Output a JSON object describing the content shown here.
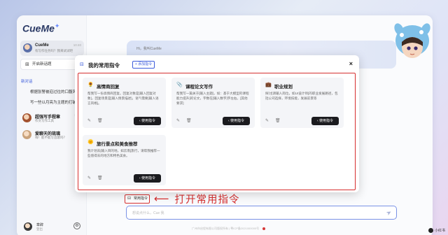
{
  "app": {
    "logo": "CueMe"
  },
  "sidebar": {
    "active_conversation": {
      "name": "CueMe",
      "subtitle": "有写作任务吗？我来试试吧",
      "time": "10:40"
    },
    "new_chat_label": "开启新话题",
    "section_label": "新对话",
    "history": [
      "根据张警被迫过往的口腹风格，",
      "写一些以月亮为主题的打破"
    ],
    "conversations": [
      {
        "name": "超强写手程章",
        "subtitle": "作文写作工具",
        "time": "10:37"
      },
      {
        "name": "爱聊天的琉璃",
        "subtitle": "嗨！能不能写首歌吗？",
        "time": ""
      }
    ],
    "user": {
      "name": "章辞",
      "sub": "登出"
    }
  },
  "main": {
    "banner_text": "Hi，我叫CueMe",
    "input_placeholder": "想说点什么，Cue 我",
    "command_button": "常用指令",
    "annotation": "打开常用指令",
    "footer": "广州市启程有限公司版权所有 | 粤ICP备2021000000号"
  },
  "modal": {
    "title": "我的常用指令",
    "add_button": "+ 添加指令",
    "close": "×",
    "cards": [
      {
        "emoji": "🌻",
        "title": "高情商回复",
        "desc": "帮我写一份高情商回复。回复对象是[输入回复对象]，回复场景是[输入情景描述]，语气需要[输入语言风格]。",
        "button": "使用指令"
      },
      {
        "emoji": "📎",
        "title": "课程论文写作",
        "desc": "帮我写一篇关于[输入主题]，如：基于大模型的课程能力提升]的论文，字数在[输入数字]字左右。[其他要求]",
        "button": "使用指令"
      },
      {
        "emoji": "💼",
        "title": "职业规划",
        "desc": "探讨[请输入岗位，如UI设计师]的职业发展路径，包括公司选择，环境技能，发展前景等",
        "button": "使用指令"
      },
      {
        "emoji": "🌞",
        "title": "旅行景点和美食推荐",
        "desc": "我计划去[输入目的地，如云南]旅行，请帮我推荐一些值得去的地方和特色美食。",
        "button": "使用指令"
      }
    ]
  },
  "watermark": "小红书"
}
